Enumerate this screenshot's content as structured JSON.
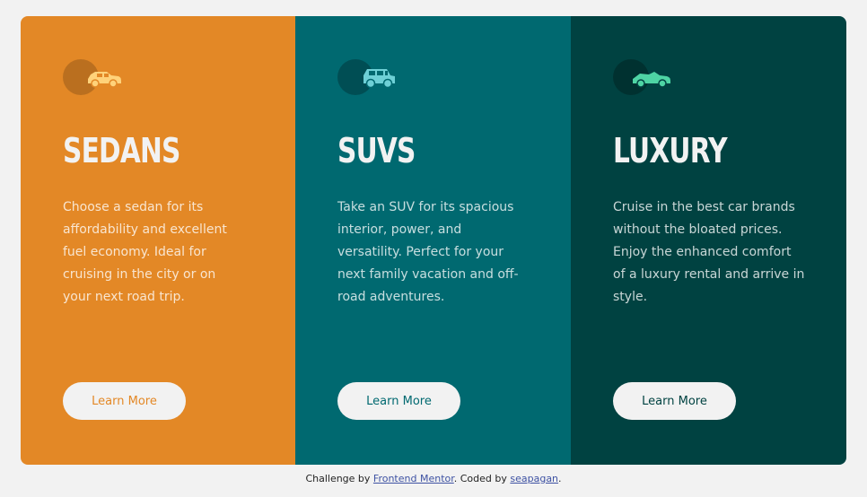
{
  "cards": [
    {
      "title": "SEDANS",
      "text": "Choose a sedan for its affordability and excellent fuel economy. Ideal for cruising in the city or on your next road trip.",
      "button_label": "Learn More",
      "icon": "sedan-car-icon",
      "color": "#e38826"
    },
    {
      "title": "SUVS",
      "text": "Take an SUV for its spacious interior, power, and versatility. Perfect for your next family vacation and off-road adventures.",
      "button_label": "Learn More",
      "icon": "suv-car-icon",
      "color": "#006970"
    },
    {
      "title": "LUXURY",
      "text": "Cruise in the best car brands without the bloated prices. Enjoy the enhanced comfort of a luxury rental and arrive in style.",
      "button_label": "Learn More",
      "icon": "luxury-car-icon",
      "color": "#004241"
    }
  ],
  "attribution": {
    "prefix": "Challenge by",
    "challenge_link": "Frontend Mentor",
    "middle": ". Coded by",
    "author_link": "seapagan",
    "suffix": "."
  },
  "colors": {
    "background": "#f2f2f2",
    "text_light": "#f2f2f2",
    "link": "#3e52a3"
  }
}
